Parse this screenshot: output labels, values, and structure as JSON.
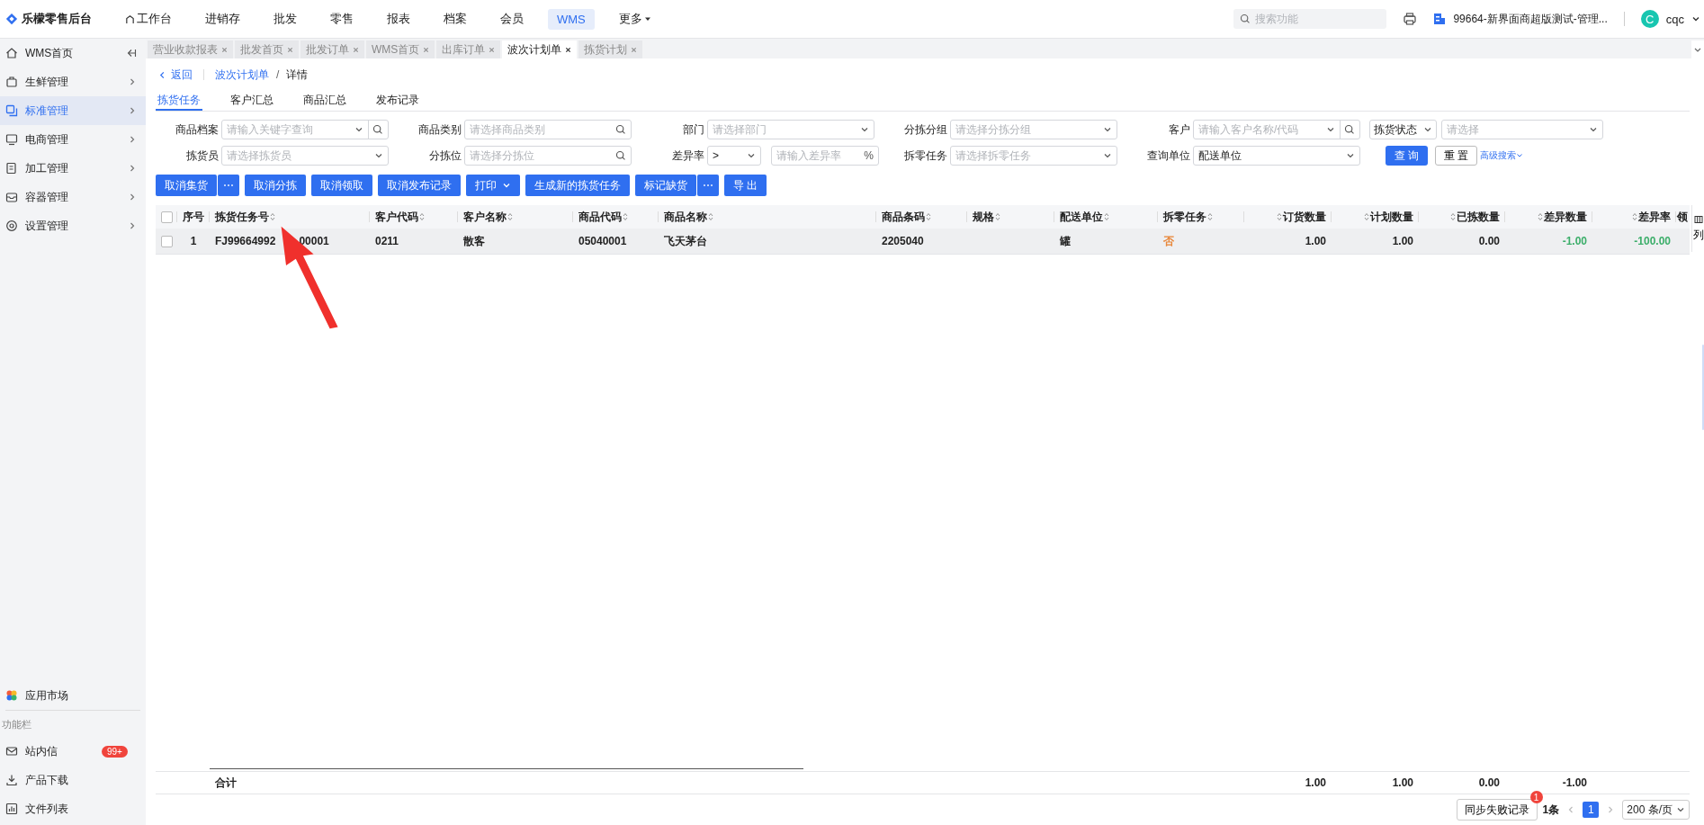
{
  "app": {
    "title": "乐檬零售后台"
  },
  "top_nav": [
    {
      "label": "工作台",
      "kind": "home",
      "selected": false
    },
    {
      "label": "进销存",
      "kind": "plain",
      "selected": false
    },
    {
      "label": "批发",
      "kind": "plain",
      "selected": false
    },
    {
      "label": "零售",
      "kind": "plain",
      "selected": false
    },
    {
      "label": "报表",
      "kind": "plain",
      "selected": false
    },
    {
      "label": "档案",
      "kind": "plain",
      "selected": false
    },
    {
      "label": "会员",
      "kind": "plain",
      "selected": false
    },
    {
      "label": "WMS",
      "kind": "plain",
      "selected": true
    },
    {
      "label": "更多",
      "kind": "menu",
      "selected": false
    }
  ],
  "search": {
    "placeholder": "搜索功能"
  },
  "store": {
    "name": "99664-新界面商超版测试-管理..."
  },
  "user": {
    "initial": "C",
    "name": "cqc"
  },
  "sidebar": {
    "items": [
      {
        "label": "WMS首页",
        "kind": "home",
        "selected": false
      },
      {
        "label": "生鲜管理",
        "kind": "fresh",
        "selected": false
      },
      {
        "label": "标准管理",
        "kind": "standard",
        "selected": true
      },
      {
        "label": "电商管理",
        "kind": "ecommerce",
        "selected": false
      },
      {
        "label": "加工管理",
        "kind": "process",
        "selected": false
      },
      {
        "label": "容器管理",
        "kind": "container",
        "selected": false
      },
      {
        "label": "设置管理",
        "kind": "settings",
        "selected": false
      }
    ],
    "market": "应用市场",
    "section_label": "功能栏",
    "tools": [
      {
        "label": "站内信",
        "kind": "mail",
        "badge": "99+"
      },
      {
        "label": "产品下载",
        "kind": "download"
      },
      {
        "label": "文件列表",
        "kind": "files"
      }
    ]
  },
  "page_tabs": [
    {
      "label": "营业收款报表",
      "selected": false
    },
    {
      "label": "批发首页",
      "selected": false
    },
    {
      "label": "批发订单",
      "selected": false
    },
    {
      "label": "WMS首页",
      "selected": false
    },
    {
      "label": "出库订单",
      "selected": false
    },
    {
      "label": "波次计划单",
      "selected": true
    },
    {
      "label": "拣货计划",
      "selected": false
    }
  ],
  "breadcrumb": {
    "back": "返回",
    "parent": "波次计划单",
    "separator": "/",
    "current": "详情"
  },
  "sub_tabs": [
    {
      "label": "拣货任务",
      "selected": true
    },
    {
      "label": "客户汇总",
      "selected": false
    },
    {
      "label": "商品汇总",
      "selected": false
    },
    {
      "label": "发布记录",
      "selected": false
    }
  ],
  "filters": [
    {
      "label": "商品档案",
      "kind": "select-search",
      "placeholder": "请输入关键字查询"
    },
    {
      "label": "商品类别",
      "kind": "search",
      "placeholder": "请选择商品类别"
    },
    {
      "label": "部门",
      "kind": "select",
      "placeholder": "请选择部门"
    },
    {
      "label": "分拣分组",
      "kind": "select",
      "placeholder": "请选择分拣分组"
    },
    {
      "label": "客户",
      "kind": "select-search",
      "placeholder": "请输入客户名称/代码"
    },
    {
      "label": "拣货状态",
      "kind": "labeled-select",
      "placeholder": "请选择"
    },
    {
      "label": "拣货员",
      "kind": "select",
      "placeholder": "请选择拣货员"
    },
    {
      "label": "分拣位",
      "kind": "search",
      "placeholder": "请选择分拣位"
    },
    {
      "label": "差异率",
      "kind": "compare",
      "operator": ">",
      "placeholder": "请输入差异率",
      "unit": "%"
    },
    {
      "label": "拆零任务",
      "kind": "select",
      "placeholder": "请选择拆零任务"
    },
    {
      "label": "查询单位",
      "kind": "select",
      "value": "配送单位"
    },
    {
      "kind": "actions",
      "query": "查 询",
      "reset": "重 置",
      "advanced": "高级搜索"
    }
  ],
  "actions": [
    {
      "label": "取消集货",
      "more": "⋯"
    },
    {
      "label": "取消分拣"
    },
    {
      "label": "取消领取"
    },
    {
      "label": "取消发布记录"
    },
    {
      "label": "打印",
      "dropdown": true
    },
    {
      "label": "生成新的拣货任务"
    },
    {
      "label": "标记缺货",
      "more": "⋯"
    },
    {
      "label": "导 出"
    }
  ],
  "table": {
    "all_checked": false,
    "columns": [
      {
        "kind": "check"
      },
      {
        "label": "序号",
        "kind": "center",
        "sortable": false
      },
      {
        "label": "拣货任务号",
        "kind": "text",
        "sortable": true
      },
      {
        "label": "客户代码",
        "kind": "text",
        "sortable": true
      },
      {
        "label": "客户名称",
        "kind": "text",
        "sortable": true
      },
      {
        "label": "商品代码",
        "kind": "text",
        "sortable": true
      },
      {
        "label": "商品名称",
        "kind": "text",
        "sortable": true
      },
      {
        "label": "商品条码",
        "kind": "text",
        "sortable": true
      },
      {
        "label": "规格",
        "kind": "text",
        "sortable": true
      },
      {
        "label": "配送单位",
        "kind": "text",
        "sortable": true
      },
      {
        "label": "拆零任务",
        "kind": "text",
        "sortable": true
      },
      {
        "label": "订货数量",
        "kind": "number",
        "sortable": true
      },
      {
        "label": "计划数量",
        "kind": "number",
        "sortable": true
      },
      {
        "label": "已拣数量",
        "kind": "number",
        "sortable": true
      },
      {
        "label": "差异数量",
        "kind": "number",
        "sortable": true
      },
      {
        "label": "差异率",
        "kind": "number",
        "sortable": true
      },
      {
        "label": "领",
        "kind": "text",
        "sortable": false
      }
    ],
    "column_settings": "列",
    "rows": [
      {
        "checked": false,
        "cells": [
          {
            "text": ""
          },
          {
            "text": "1"
          },
          {
            "text": "FJ99664992",
            "tail": "00001"
          },
          {
            "text": "0211"
          },
          {
            "text": "散客"
          },
          {
            "text": "05040001"
          },
          {
            "text": "飞天茅台"
          },
          {
            "text": "2205040"
          },
          {
            "text": ""
          },
          {
            "text": "罐"
          },
          {
            "text": "否",
            "color": "#e8873a"
          },
          {
            "text": "1.00"
          },
          {
            "text": "1.00"
          },
          {
            "text": "0.00"
          },
          {
            "text": "-1.00",
            "color": "#3cae6a"
          },
          {
            "text": "-100.00",
            "color": "#3cae6a"
          },
          {
            "text": ""
          }
        ]
      }
    ],
    "totals": {
      "label": "合计",
      "values": [
        "1.00",
        "1.00",
        "0.00",
        "-1.00"
      ]
    }
  },
  "pagination": {
    "sync_button": "同步失败记录",
    "sync_badge": "1",
    "total": "1条",
    "pages": [
      {
        "label": "1",
        "selected": true
      }
    ],
    "page_size": "200 条/页"
  }
}
